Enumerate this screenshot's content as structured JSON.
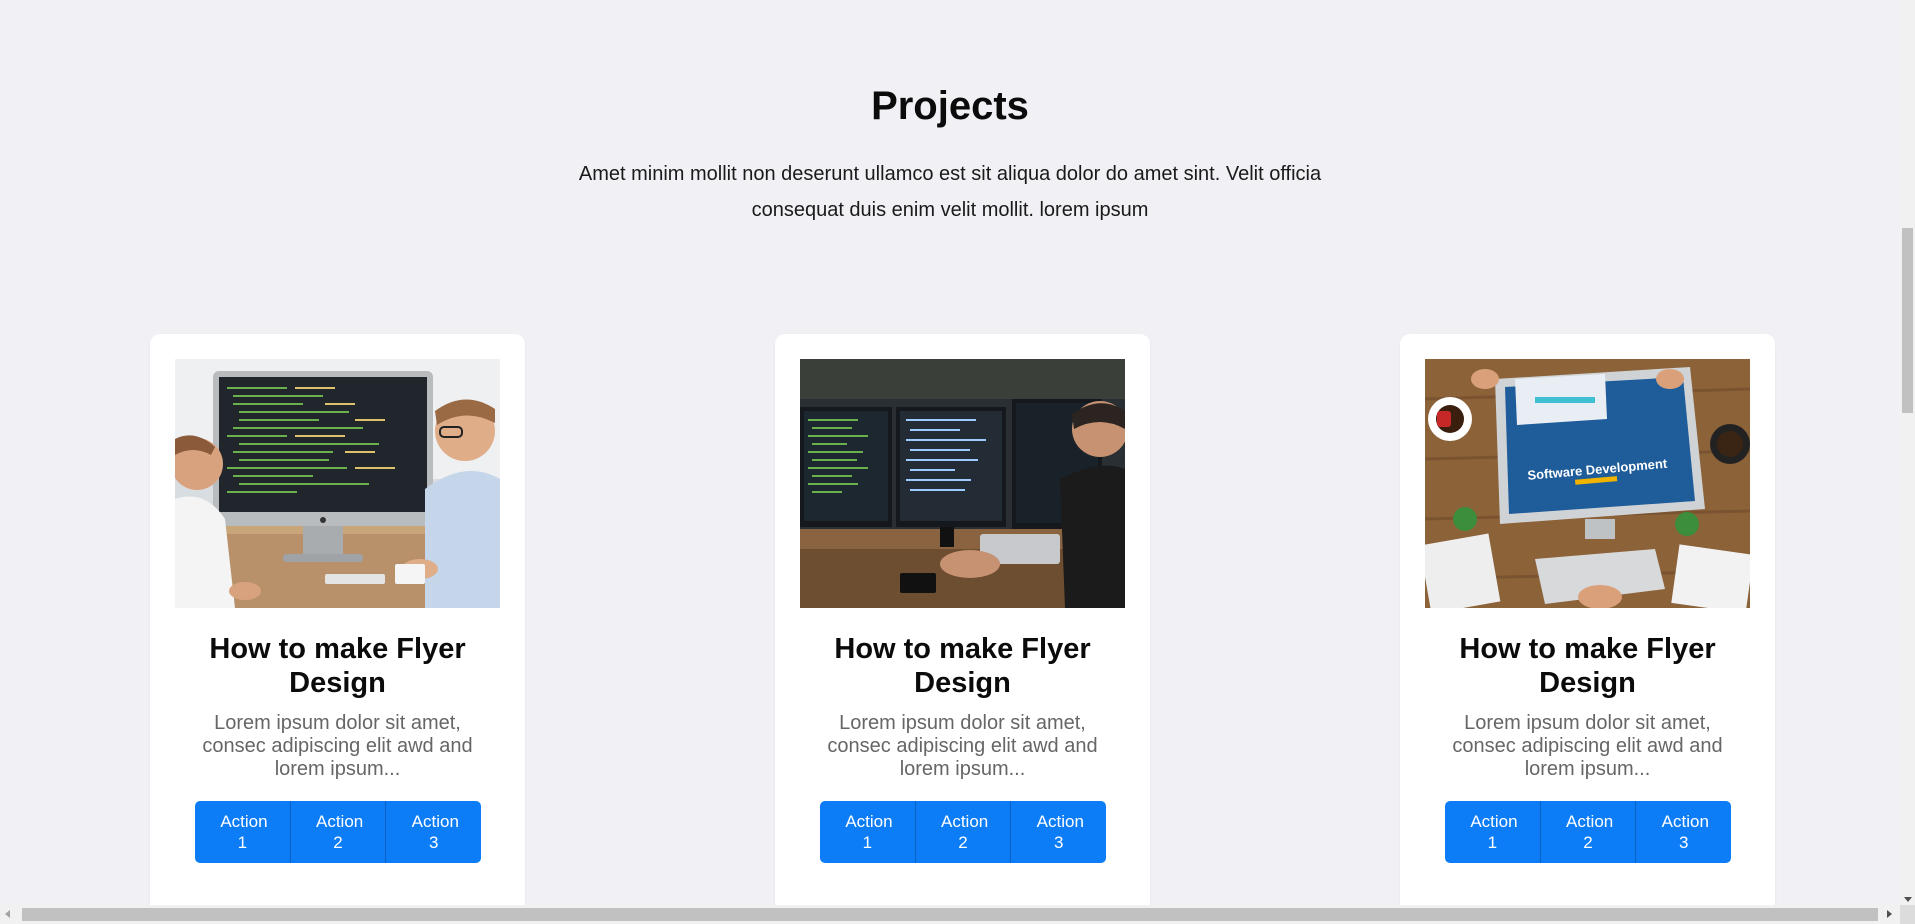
{
  "section": {
    "title": "Projects",
    "description": "Amet minim mollit non deserunt ullamco est sit aliqua dolor do amet sint. Velit officia consequat duis enim velit mollit. lorem ipsum"
  },
  "cards": [
    {
      "image": "photo-two-developers-at-imac-with-code",
      "title": "How to make Flyer Design",
      "text": "Lorem ipsum dolor sit amet, consec adipiscing elit awd and lorem ipsum...",
      "actions": [
        "Action 1",
        "Action 2",
        "Action 3"
      ]
    },
    {
      "image": "photo-developer-at-dual-monitors-with-code",
      "title": "How to make Flyer Design",
      "text": "Lorem ipsum dolor sit amet, consec adipiscing elit awd and lorem ipsum...",
      "actions": [
        "Action 1",
        "Action 2",
        "Action 3"
      ]
    },
    {
      "image": "photo-desk-top-view-software-development-screen",
      "image_caption": "Software Development",
      "title": "How to make Flyer Design",
      "text": "Lorem ipsum dolor sit amet, consec adipiscing elit awd and lorem ipsum...",
      "actions": [
        "Action 1",
        "Action 2",
        "Action 3"
      ]
    }
  ],
  "colors": {
    "page_background": "#f0f0f5",
    "card_background": "#ffffff",
    "button": "#0d7df7",
    "body_text": "#666666"
  }
}
